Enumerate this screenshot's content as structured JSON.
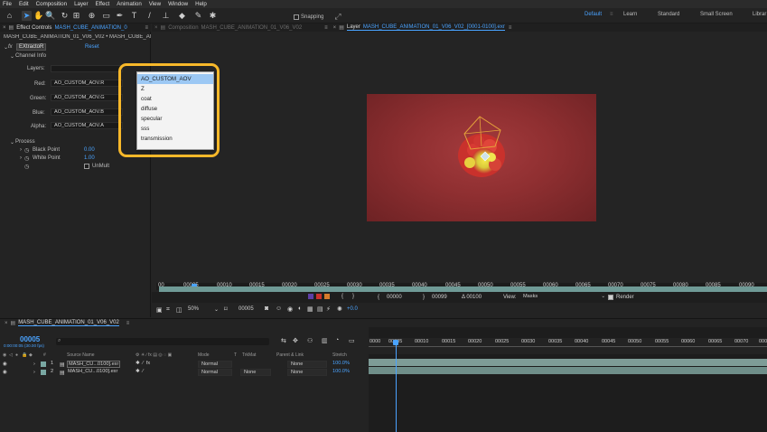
{
  "menu": [
    "File",
    "Edit",
    "Composition",
    "Layer",
    "Effect",
    "Animation",
    "View",
    "Window",
    "Help"
  ],
  "toolbar": {
    "snapping_label": "Snapping",
    "workspaces": [
      "Default",
      "Learn",
      "Standard",
      "Small Screen",
      "Librar"
    ]
  },
  "effect_controls": {
    "tab_title": "Effect Controls",
    "tab_comp": "MASH_CUBE_ANIMATION_0",
    "breadcrumb": "MASH_CUBE_ANIMATION_01_V06_V02 • MASH_CUBE_ANIMATIO",
    "effect_name": "EXtractoR",
    "reset_label": "Reset",
    "channel_info": "Channel Info",
    "layers_label": "Layers:",
    "red_label": "Red:",
    "red_value": "AO_CUSTOM_AOV.R",
    "green_label": "Green:",
    "green_value": "AO_CUSTOM_AOV.G",
    "blue_label": "Blue:",
    "blue_value": "AO_CUSTOM_AOV.B",
    "alpha_label": "Alpha:",
    "alpha_value": "AO_CUSTOM_AOV.A",
    "process_label": "Process",
    "black_point_label": "Black Point",
    "black_point_value": "0.00",
    "white_point_label": "White Point",
    "white_point_value": "1.00",
    "unmult_label": "UnMult"
  },
  "dropdown": {
    "items": [
      "AO_CUSTOM_AOV",
      "Z",
      "coat",
      "diffuse",
      "specular",
      "sss",
      "transmission"
    ],
    "selected_index": 0
  },
  "viewer": {
    "comp_tab_prefix": "Composition",
    "comp_tab_name": "MASH_CUBE_ANIMATION_01_V06_V02",
    "layer_tab_prefix": "Layer",
    "layer_tab_name": "MASH_CUBE_ANIMATION_01_V06_V02_[0001-0100].exr",
    "ruler_ticks": [
      "00",
      "00005",
      "00010",
      "00015",
      "00020",
      "00025",
      "00030",
      "00035",
      "00040",
      "00045",
      "00050",
      "00055",
      "00060",
      "00065",
      "00070",
      "00075",
      "00080",
      "00085",
      "00090"
    ],
    "in_point": "00000",
    "out_point": "00099",
    "duration": "Δ 00100",
    "view_label": "View:",
    "view_value": "Masks",
    "render_label": "Render",
    "zoom": "50%",
    "current_frame": "00005",
    "exposure": "+0.0"
  },
  "timeline": {
    "comp_name": "MASH_CUBE_ANIMATION_01_V06_V02",
    "timecode": "00005",
    "timecode_sub": "0:00:00:05 (30.00 fps)",
    "search_placeholder": "",
    "columns": {
      "source_name": "Source Name",
      "mode": "Mode",
      "trkmat": "TrkMat",
      "parent": "Parent & Link",
      "stretch": "Stretch"
    },
    "layers": [
      {
        "num": "1",
        "name": "MASH_CU...0100].exr",
        "mode": "Normal",
        "trkmat": "",
        "parent": "None",
        "stretch": "100.0%"
      },
      {
        "num": "2",
        "name": "MASH_CU...0100].exr",
        "mode": "Normal",
        "trkmat": "None",
        "parent": "None",
        "stretch": "100.0%"
      }
    ],
    "ruler_ticks": [
      "0000",
      "00005",
      "00010",
      "00015",
      "00020",
      "00025",
      "00030",
      "00035",
      "00040",
      "00045",
      "00050",
      "00055",
      "00060",
      "00065",
      "00070",
      "0007"
    ]
  },
  "colors": {
    "accent": "#4aa3ff",
    "highlight": "#f7b82a",
    "layer_bar": "#7e9c97",
    "render_bg": "#8f2f31"
  }
}
